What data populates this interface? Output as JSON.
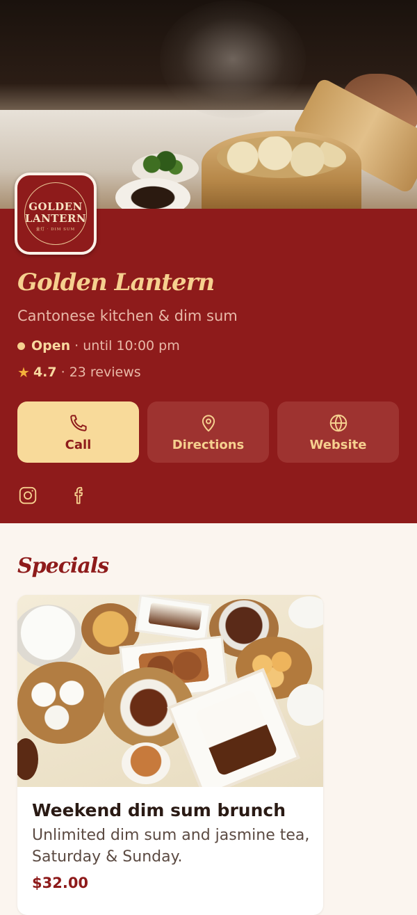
{
  "restaurant": {
    "logo_line1": "GOLDEN",
    "logo_line2": "LANTERN",
    "logo_line3": "金灯 · DIM SUM",
    "name": "Golden Lantern",
    "tagline": "Cantonese kitchen & dim sum",
    "status_label": "Open",
    "status_detail": "· until 10:00 pm",
    "rating": "4.7",
    "reviews": "· 23 reviews"
  },
  "actions": [
    {
      "label": "Call",
      "icon": "phone-icon"
    },
    {
      "label": "Directions",
      "icon": "map-pin-icon"
    },
    {
      "label": "Website",
      "icon": "globe-icon"
    }
  ],
  "socials": [
    {
      "icon": "instagram-icon"
    },
    {
      "icon": "facebook-icon"
    }
  ],
  "specials": {
    "title": "Specials",
    "items": [
      {
        "title": "Weekend dim sum brunch",
        "description": "Unlimited dim sum and jasmine tea, Saturday & Sunday.",
        "price": "$32.00"
      }
    ]
  },
  "colors": {
    "brand": "#8e1b1b",
    "accent": "#f6d08f",
    "background": "#fbf5ef"
  }
}
